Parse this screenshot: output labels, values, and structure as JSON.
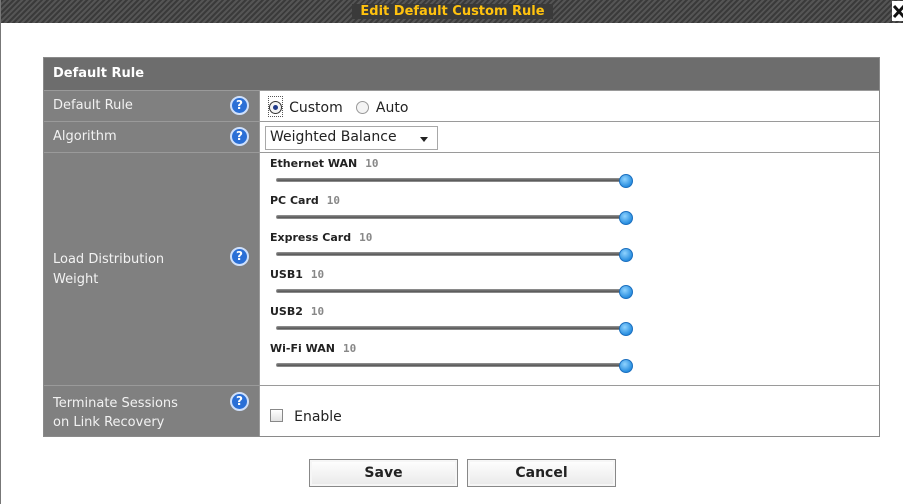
{
  "dialog": {
    "title": "Edit Default Custom Rule"
  },
  "table": {
    "header": "Default Rule",
    "rows": {
      "default_rule": {
        "label": "Default Rule",
        "options": [
          "Custom",
          "Auto"
        ],
        "selected": "Custom"
      },
      "algorithm": {
        "label": "Algorithm",
        "selected": "Weighted Balance"
      },
      "load_distribution": {
        "label": "Load Distribution Weight",
        "label_line1": "Load Distribution",
        "label_line2": "Weight",
        "sliders": [
          {
            "name": "Ethernet WAN",
            "value": "10",
            "fraction": 1.0
          },
          {
            "name": "PC Card",
            "value": "10",
            "fraction": 1.0
          },
          {
            "name": "Express Card",
            "value": "10",
            "fraction": 1.0
          },
          {
            "name": "USB1",
            "value": "10",
            "fraction": 1.0
          },
          {
            "name": "USB2",
            "value": "10",
            "fraction": 1.0
          },
          {
            "name": "Wi-Fi WAN",
            "value": "10",
            "fraction": 1.0
          }
        ]
      },
      "terminate_sessions": {
        "label_line1": "Terminate Sessions",
        "label_line2": "on Link Recovery",
        "checkbox_label": "Enable",
        "checked": false
      }
    }
  },
  "buttons": {
    "save": "Save",
    "cancel": "Cancel"
  },
  "icons": {
    "help": "?",
    "close": "close-icon"
  },
  "colors": {
    "title_text": "#ffc20e",
    "header_bg": "#6d6d6d",
    "label_bg": "#808080",
    "knob": "#2a8fe0"
  }
}
